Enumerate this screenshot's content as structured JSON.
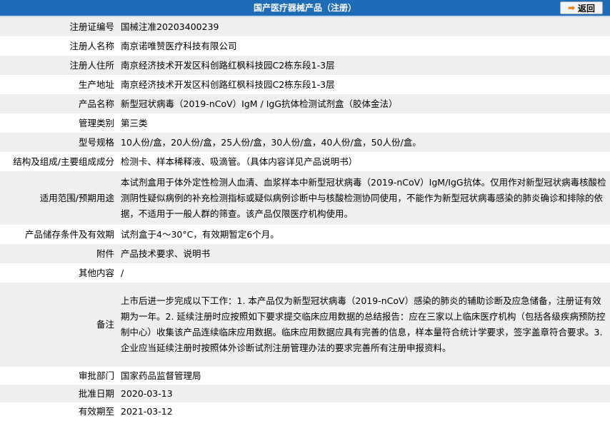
{
  "header": {
    "title": "国产医疗器械产品（注册）",
    "back_label": "返回"
  },
  "rows": [
    {
      "label": "注册证编号",
      "value": "国械注准20203400239"
    },
    {
      "label": "注册人名称",
      "value": "南京诺唯赞医疗科技有限公司"
    },
    {
      "label": "注册人住所",
      "value": "南京经济技术开发区科创路红枫科技园C2栋东段1-3层"
    },
    {
      "label": "生产地址",
      "value": "南京经济技术开发区科创路红枫科技园C2栋东段1-3层"
    },
    {
      "label": "产品名称",
      "value": "新型冠状病毒（2019-nCoV）IgM / IgG抗体检测试剂盒（胶体金法）"
    },
    {
      "label": "管理类别",
      "value": "第三类"
    },
    {
      "label": "型号规格",
      "value": "10人份/盒，20人份/盒，25人份/盒，30人份/盒，40人份/盒，50人份/盒。"
    },
    {
      "label": "结构及组成/主要组成成分",
      "value": "检测卡、样本稀释液、吸滴管。（具体内容详见产品说明书）"
    },
    {
      "label": "适用范围/预期用途",
      "value": "本试剂盒用于体外定性检测人血清、血浆样本中新型冠状病毒（2019-nCoV）IgM/IgG抗体。仅用作对新型冠状病毒核酸检测阴性疑似病例的补充检测指标或疑似病例诊断中与核酸检测协同使用，不能作为新型冠状病毒感染的肺炎确诊和排除的依据，不适用于一般人群的筛查。该产品仅限医疗机构使用。"
    },
    {
      "label": "产品储存条件及有效期",
      "value": "试剂盒于4～30°C，有效期暂定6个月。"
    },
    {
      "label": "附件",
      "value": "产品技术要求、说明书"
    },
    {
      "label": "其他内容",
      "value": "/"
    },
    {
      "label": "备注",
      "value": "上市后进一步完成以下工作：1. 本产品仅为新型冠状病毒（2019-nCoV）感染的肺炎的辅助诊断及应急储备，注册证有效期为一年。2. 延续注册时应按照如下要求提交临床应用数据的总结报告：应在三家以上临床医疗机构（包括各级疾病预防控制中心）收集该产品连续临床应用数据。临床应用数据应具有完善的信息，样本量符合统计学要求，签字盖章符合要求。3. 企业应当延续注册时按照体外诊断试剂注册管理办法的要求完善所有注册申报资料。"
    },
    {
      "label": "审批部门",
      "value": "国家药品监督管理局"
    },
    {
      "label": "批准日期",
      "value": "2020-03-13"
    },
    {
      "label": "有效期至",
      "value": "2021-03-12"
    }
  ]
}
